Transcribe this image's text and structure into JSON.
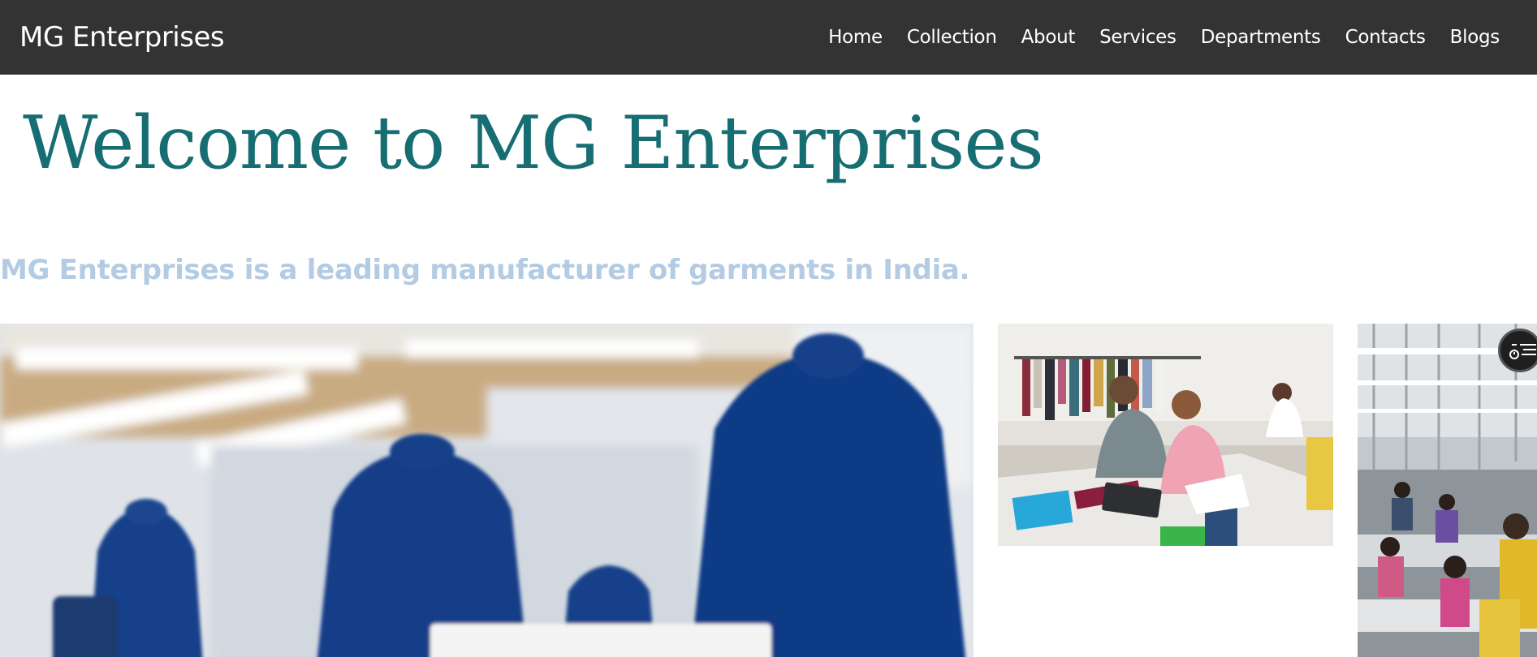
{
  "navbar": {
    "brand": "MG Enterprises",
    "links": [
      "Home",
      "Collection",
      "About",
      "Services",
      "Departments",
      "Contacts",
      "Blogs"
    ]
  },
  "hero": {
    "title": "Welcome to MG Enterprises",
    "subtitle": "MG Enterprises is a leading manufacturer of garments in India."
  },
  "colors": {
    "navbar_bg": "#333333",
    "title": "#176e72",
    "subtitle": "#b3cbe3"
  },
  "icons": {
    "floating_button": "list-menu-icon"
  }
}
